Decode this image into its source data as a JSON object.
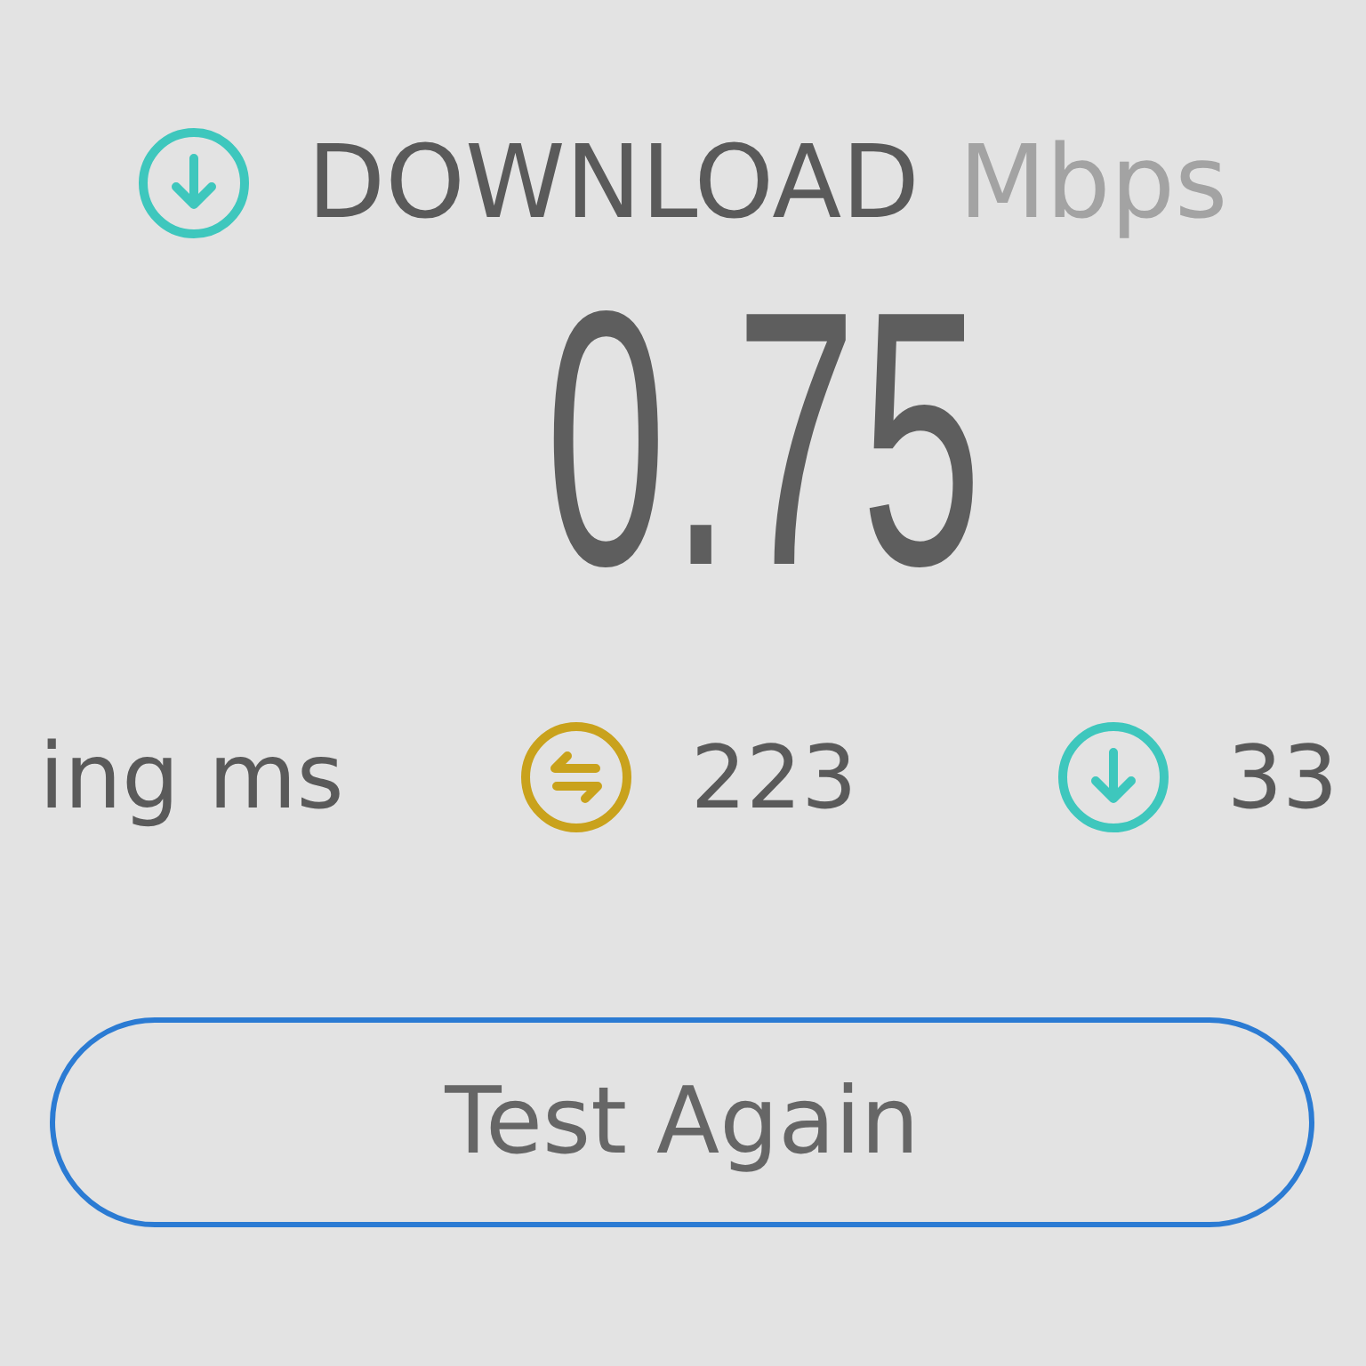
{
  "result": {
    "label": "DOWNLOAD",
    "unit": "Mbps",
    "value": "0.75"
  },
  "stats": {
    "label": "ing ms",
    "items": [
      {
        "kind": "exchange",
        "value": "223"
      },
      {
        "kind": "download",
        "value": "33"
      }
    ]
  },
  "button": {
    "label": "Test Again"
  }
}
